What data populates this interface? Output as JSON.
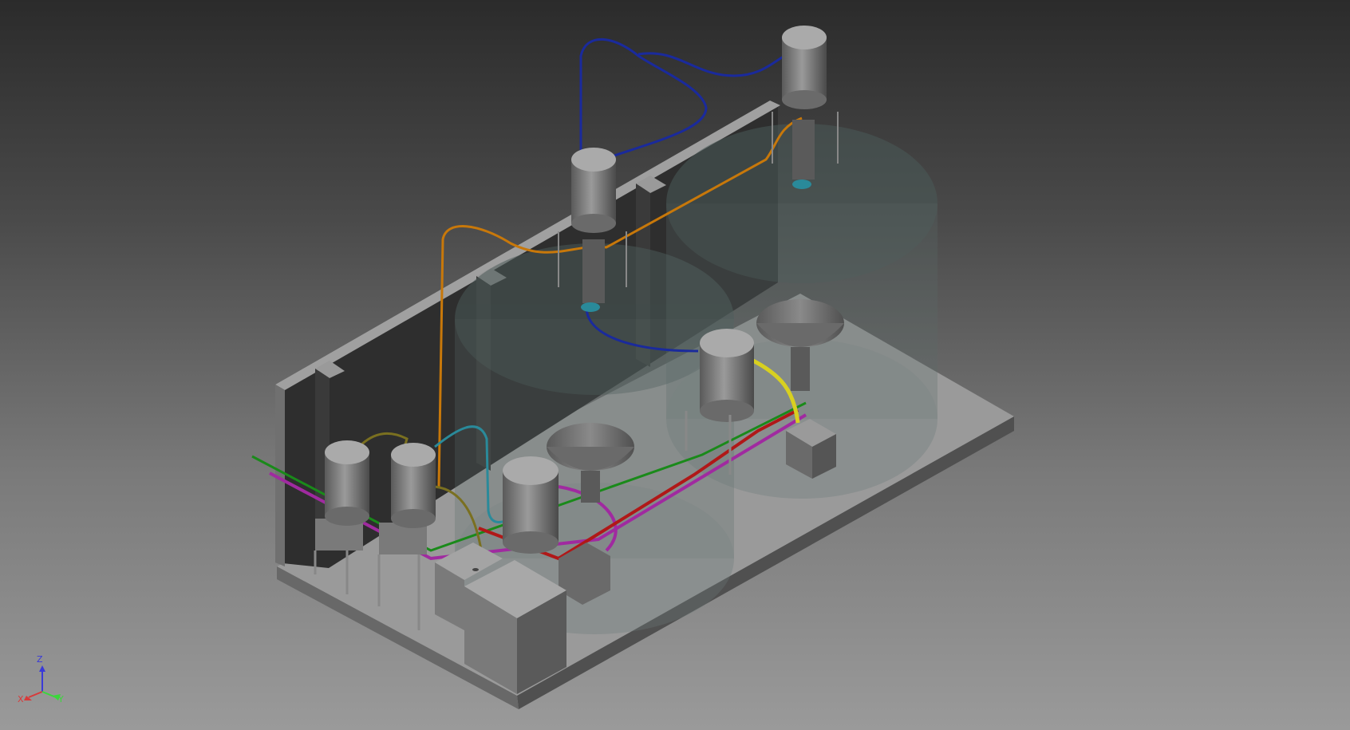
{
  "view": {
    "background_top": "#2b2b2b",
    "background_bottom": "#9a9a9a",
    "model_color": "#8a8a8a"
  },
  "pipes": {
    "blue": "#1a2a9c",
    "orange": "#c8780a",
    "green": "#1a8a1a",
    "magenta": "#a02aa0",
    "yellow": "#d8d020",
    "red": "#b01818",
    "teal": "#2a8a9a",
    "olive": "#7a7020"
  },
  "triad": {
    "z_label": "Z",
    "x_label": "X",
    "y_label": "Y",
    "z_color": "#3a3ad8",
    "x_color": "#d83a3a",
    "y_color": "#3ad83a"
  }
}
